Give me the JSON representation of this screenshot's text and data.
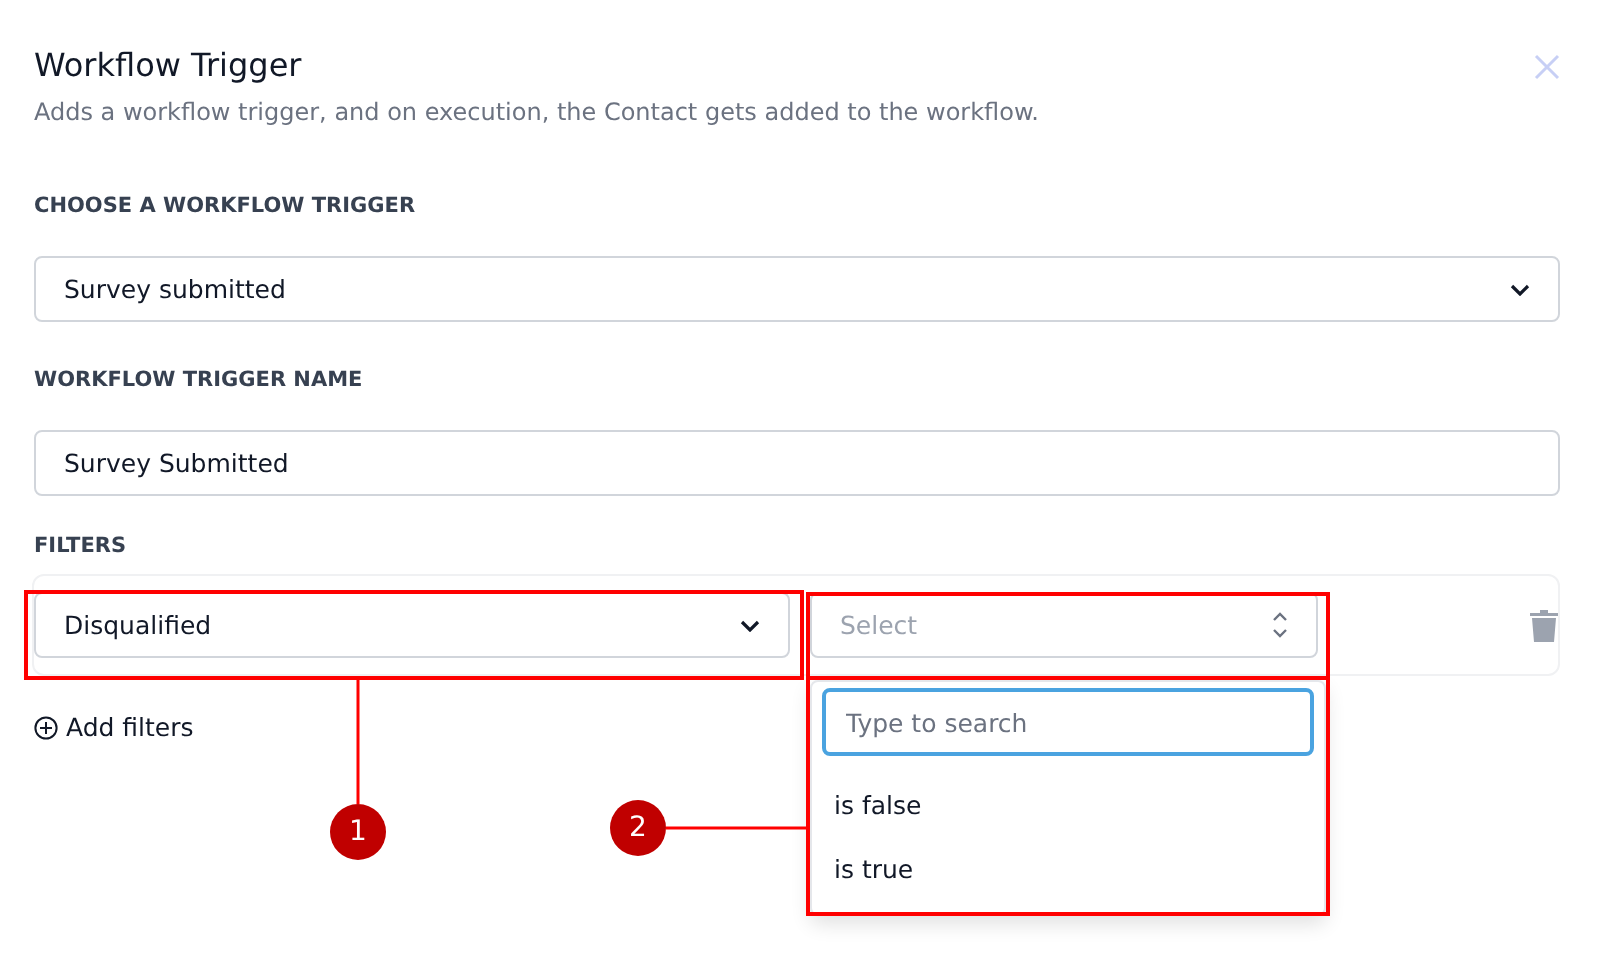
{
  "dialog": {
    "title": "Workflow Trigger",
    "subtitle": "Adds a workflow trigger, and on execution, the Contact gets added to the workflow."
  },
  "trigger": {
    "label": "CHOOSE A WORKFLOW TRIGGER",
    "value": "Survey submitted"
  },
  "trigger_name": {
    "label": "WORKFLOW TRIGGER NAME",
    "value": "Survey Submitted"
  },
  "filters": {
    "label": "FILTERS",
    "field": {
      "value": "Disqualified"
    },
    "operator": {
      "placeholder": "Select",
      "expanded": true
    },
    "dropdown": {
      "search_placeholder": "Type to search",
      "options": [
        {
          "label": "is false",
          "selected": false
        },
        {
          "label": "is true",
          "selected": false
        }
      ]
    },
    "add_button": "Add filters"
  },
  "callouts": [
    {
      "label": "1"
    },
    {
      "label": "2"
    }
  ]
}
